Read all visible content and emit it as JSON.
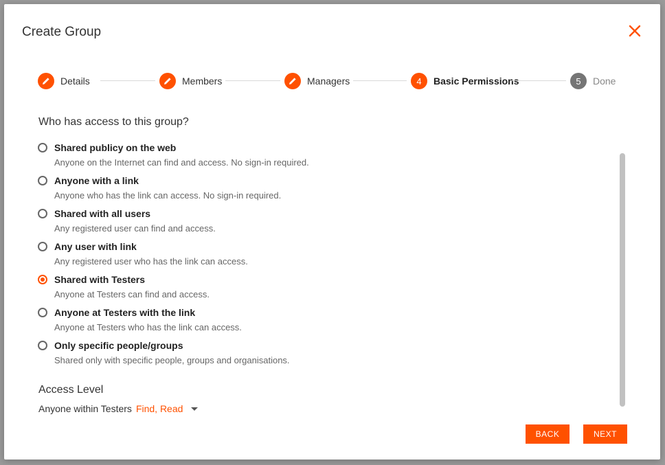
{
  "colors": {
    "accent": "#ff5100",
    "inactive_step": "#757575"
  },
  "dialog": {
    "title": "Create Group",
    "close_icon": "close-icon"
  },
  "steps": [
    {
      "label": "Details",
      "state": "done",
      "icon": "pencil-icon"
    },
    {
      "label": "Members",
      "state": "done",
      "icon": "pencil-icon"
    },
    {
      "label": "Managers",
      "state": "done",
      "icon": "pencil-icon"
    },
    {
      "label": "Basic Permissions",
      "state": "active",
      "number": "4"
    },
    {
      "label": "Done",
      "state": "pending",
      "number": "5"
    }
  ],
  "access": {
    "question": "Who has access to this group?",
    "selected_index": 4,
    "options": [
      {
        "title": "Shared publicy on the web",
        "desc": "Anyone on the Internet can find and access. No sign-in required."
      },
      {
        "title": "Anyone with a link",
        "desc": "Anyone who has the link can access. No sign-in required."
      },
      {
        "title": "Shared with all users",
        "desc": "Any registered user can find and access."
      },
      {
        "title": "Any user with link",
        "desc": "Any registered user who has the link can access."
      },
      {
        "title": "Shared with Testers",
        "desc": "Anyone at Testers can find and access."
      },
      {
        "title": "Anyone at Testers with the link",
        "desc": "Anyone at Testers who has the link can access."
      },
      {
        "title": "Only specific people/groups",
        "desc": "Shared only with specific people, groups and organisations."
      }
    ]
  },
  "access_level": {
    "title": "Access Level",
    "label": "Anyone within Testers",
    "value": "Find, Read"
  },
  "buttons": {
    "back": "BACK",
    "next": "NEXT"
  }
}
